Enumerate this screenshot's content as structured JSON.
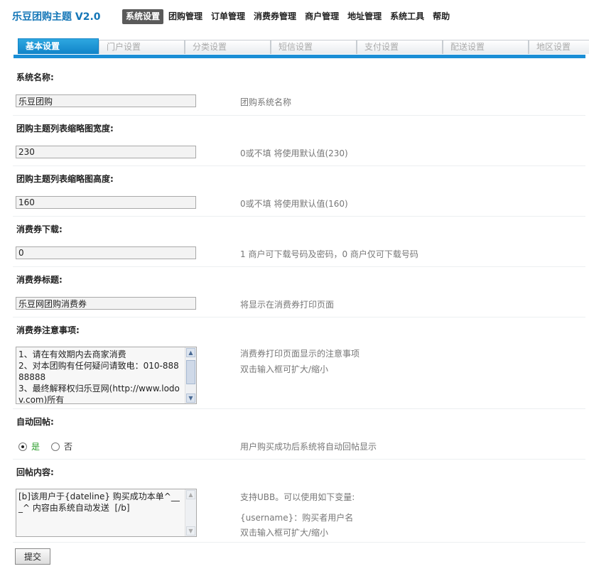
{
  "app": {
    "title": "乐豆团购主题 V2.0"
  },
  "topnav": [
    {
      "label": "系统设置",
      "active": true
    },
    {
      "label": "团购管理"
    },
    {
      "label": "订单管理"
    },
    {
      "label": "消费券管理"
    },
    {
      "label": "商户管理"
    },
    {
      "label": "地址管理"
    },
    {
      "label": "系统工具"
    },
    {
      "label": "帮助"
    }
  ],
  "tabs": [
    {
      "label": "基本设置",
      "active": true
    },
    {
      "label": "门户设置"
    },
    {
      "label": "分类设置"
    },
    {
      "label": "短信设置"
    },
    {
      "label": "支付设置"
    },
    {
      "label": "配送设置"
    },
    {
      "label": "地区设置"
    }
  ],
  "fields": {
    "system_name": {
      "label": "系统名称:",
      "value": "乐豆团购",
      "hint": "团购系统名称"
    },
    "thumb_width": {
      "label": "团购主题列表缩略图宽度:",
      "value": "230",
      "hint": "0或不填 将使用默认值(230)"
    },
    "thumb_height": {
      "label": "团购主题列表缩略图高度:",
      "value": "160",
      "hint": "0或不填 将使用默认值(160)"
    },
    "voucher_download": {
      "label": "消费券下载:",
      "value": "0",
      "hint": "1 商户可下载号码及密码，0 商户仅可下载号码"
    },
    "voucher_title": {
      "label": "消费券标题:",
      "value": "乐豆网团购消费券",
      "hint": "将显示在消费券打印页面"
    },
    "voucher_notes": {
      "label": "消费券注意事项:",
      "value": "1、请在有效期内去商家消费\n2、对本团购有任何疑问请致电：010-88888888\n3、最终解释权归乐豆网(http://www.lodov.com)所有",
      "hint1": "消费券打印页面显示的注意事项",
      "hint2": "双击输入框可扩大/缩小"
    },
    "auto_reply": {
      "label": "自动回帖:",
      "yes": "是",
      "no": "否",
      "selected": "yes",
      "hint": "用户购买成功后系统将自动回帖显示"
    },
    "reply_content": {
      "label": "回帖内容:",
      "value": "[b]该用户于{dateline} 购买成功本单^___^ 内容由系统自动发送  [/b]",
      "hint1": "支持UBB。可以使用如下变量:",
      "hint2": "{username}：购买者用户名",
      "hint3": "双击输入框可扩大/缩小"
    }
  },
  "submit": {
    "label": "提交"
  }
}
